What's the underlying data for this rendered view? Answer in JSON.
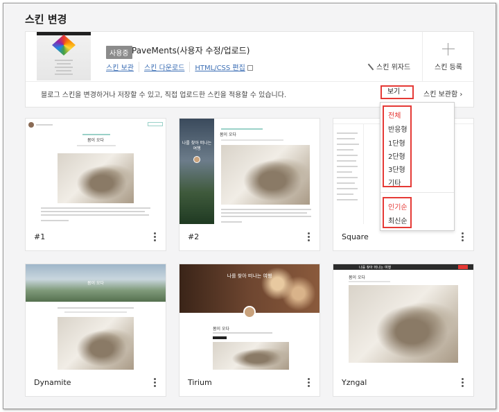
{
  "page": {
    "title": "스킨 변경"
  },
  "current_skin": {
    "badge": "사용중",
    "name": "PaveMents(사용자 수정/업로드)",
    "links": [
      "스킨 보관",
      "스킨 다운로드",
      "HTML/CSS 편집"
    ],
    "wizard_label": "스킨 위자드",
    "register_label": "스킨 등록",
    "description": "블로그 스킨을 변경하거나 저장할 수 있고, 직접 업로드한 스킨을 적용할 수 있습니다.",
    "view_label": "보기",
    "locker_label": "스킨 보관함"
  },
  "view_menu": {
    "type_items": [
      "전체",
      "반응형",
      "1단형",
      "2단형",
      "3단형",
      "기타"
    ],
    "sort_items": [
      "인기순",
      "최신순"
    ]
  },
  "skins": [
    {
      "name": "#1",
      "thumb_title": "봄이 오다"
    },
    {
      "name": "#2",
      "thumb_title": "나를 찾아 떠나는 여행",
      "thumb_sub": "봄이 오다"
    },
    {
      "name": "Square"
    },
    {
      "name": "Dynamite",
      "thumb_title": "봄이 오다"
    },
    {
      "name": "Tirium",
      "thumb_title": "나를 찾아 떠나는 여행",
      "thumb_sub": "봄이 오다"
    },
    {
      "name": "Yzngal",
      "thumb_title": "나를 찾아 떠나는 여행",
      "thumb_sub": "봄이 오다"
    }
  ],
  "colors": {
    "accent_red": "#e53935",
    "link_blue": "#3d6fb5",
    "badge_gray": "#8b8b8b"
  }
}
